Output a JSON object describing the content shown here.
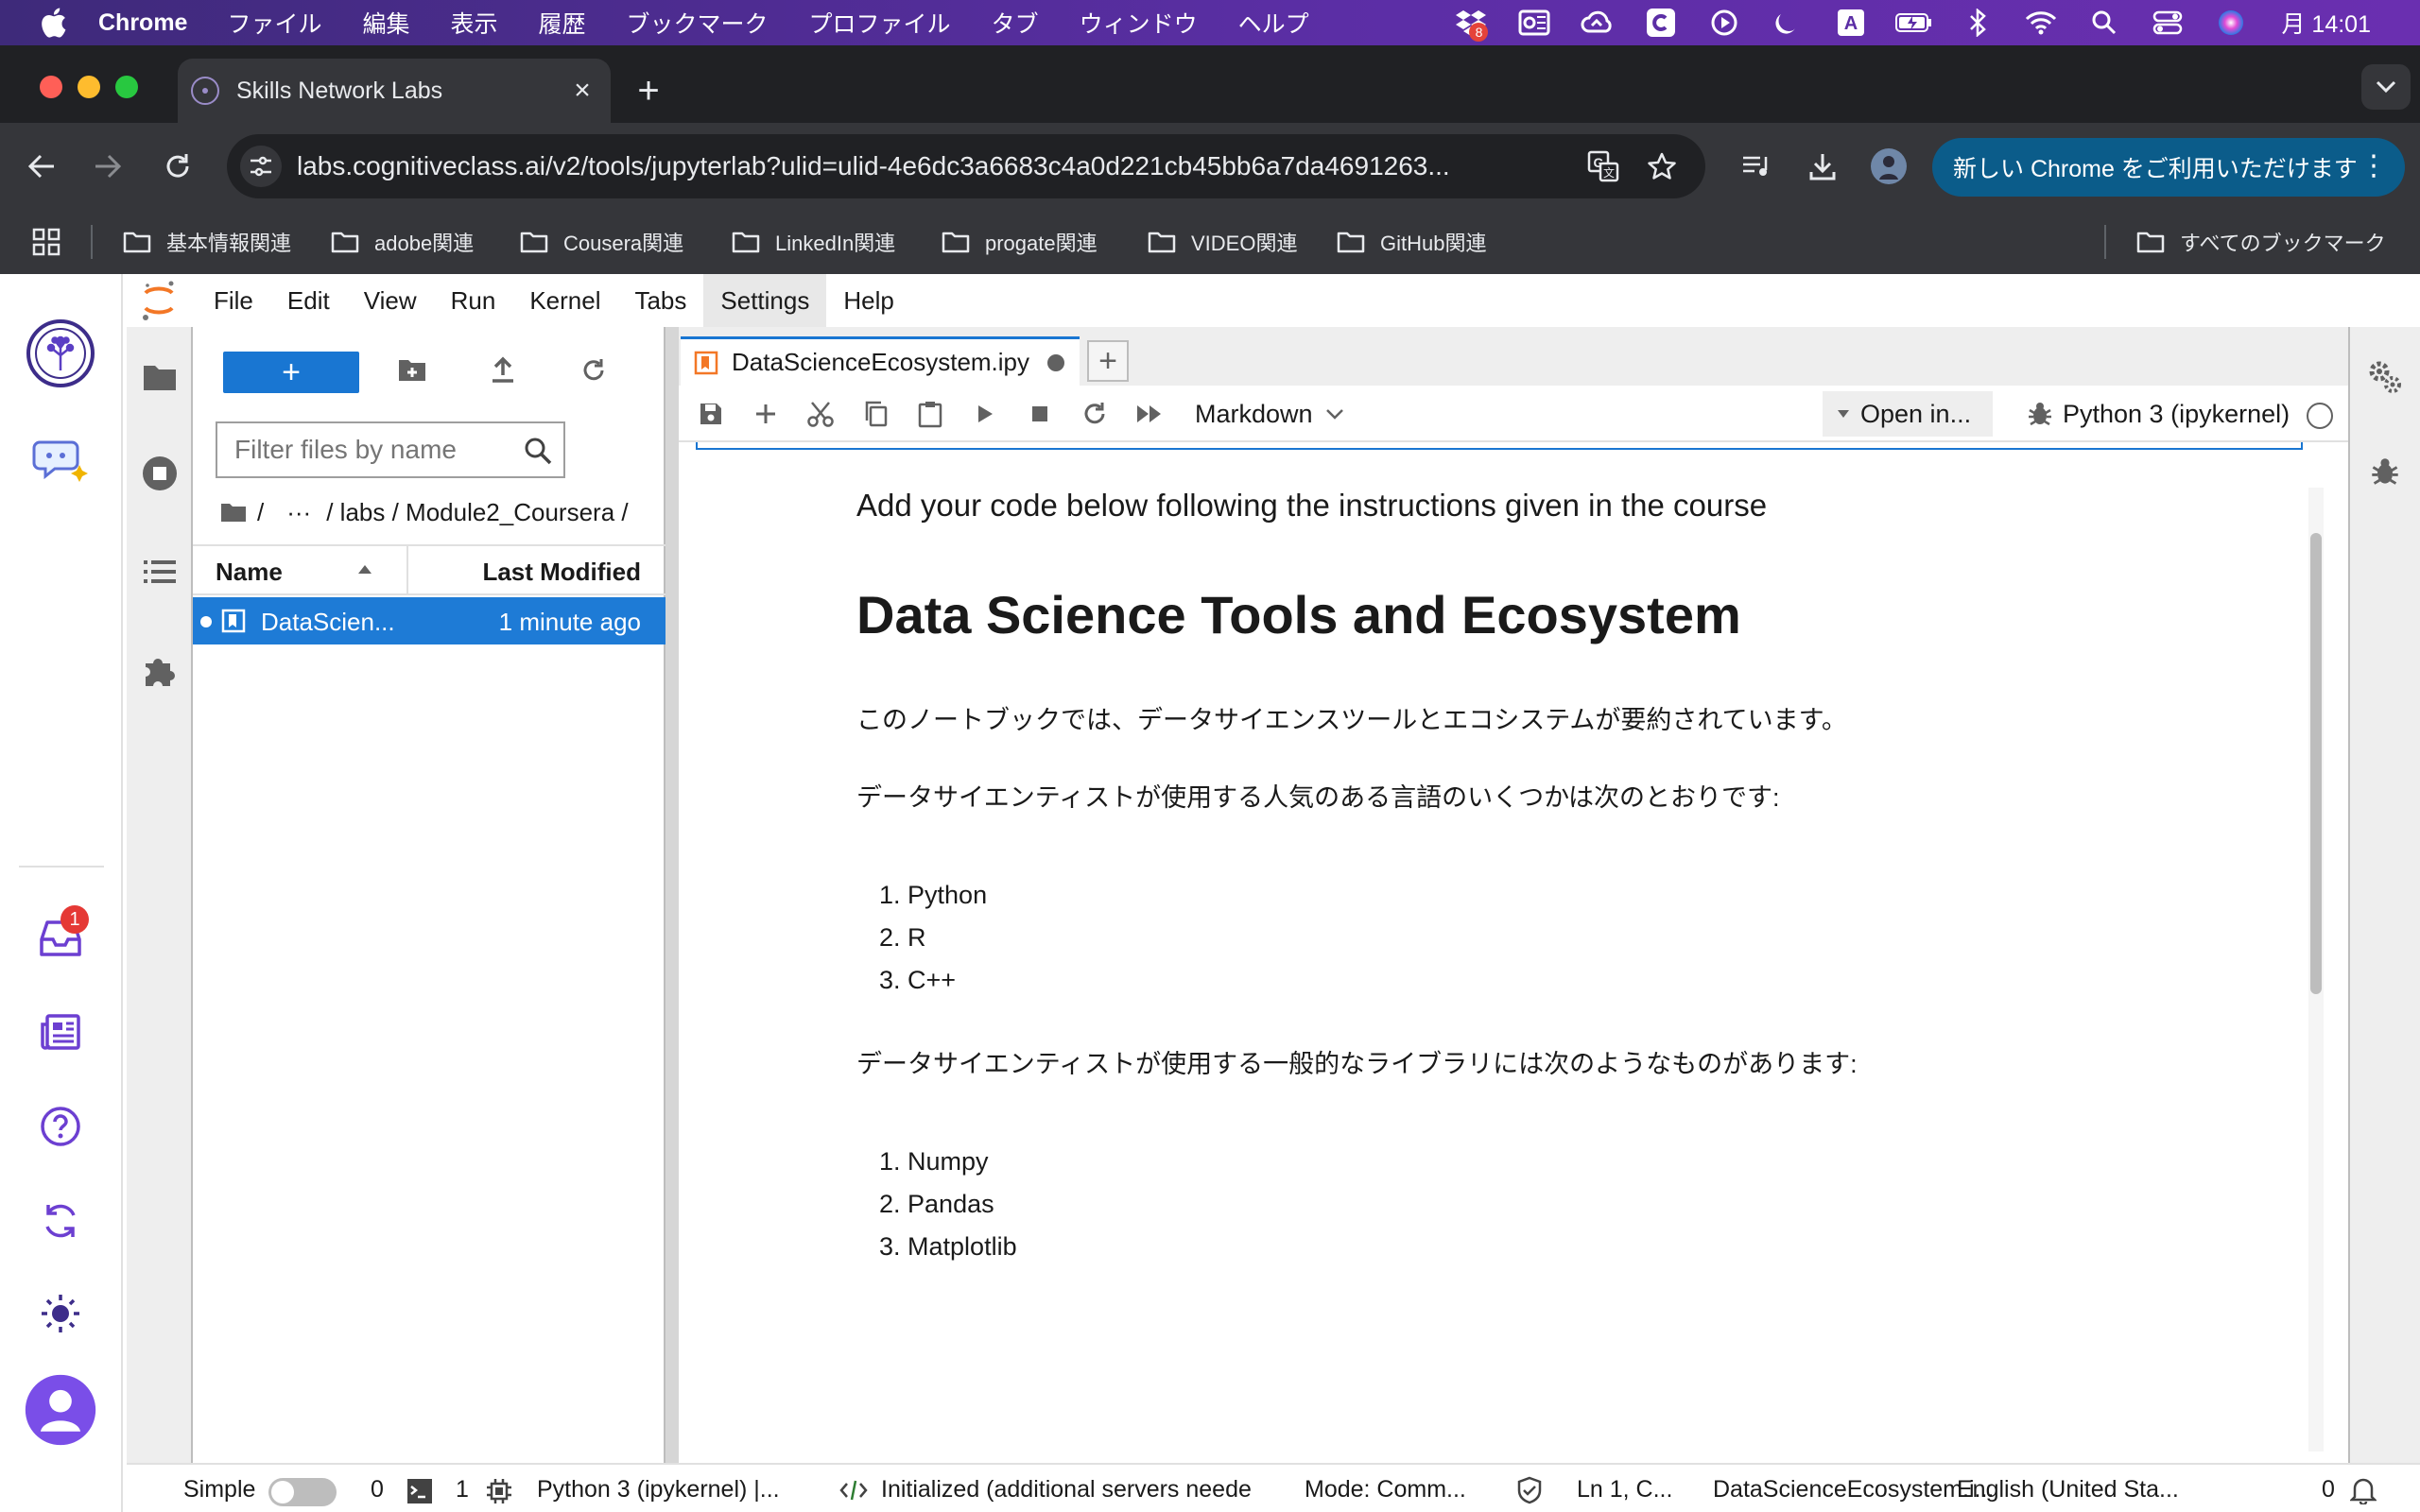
{
  "mac_menubar": {
    "app_name": "Chrome",
    "menus": [
      "ファイル",
      "編集",
      "表示",
      "履歴",
      "ブックマーク",
      "プロファイル",
      "タブ",
      "ウィンドウ",
      "ヘルプ"
    ],
    "dropbox_badge": "8",
    "clock": "月 14:01"
  },
  "browser": {
    "tab_title": "Skills Network Labs",
    "url": "labs.cognitiveclass.ai/v2/tools/jupyterlab?ulid=ulid-4e6dc3a6683c4a0d221cb45bb6a7da4691263...",
    "update_button": "新しい Chrome をご利用いただけます",
    "bookmarks": [
      "基本情報関連",
      "adobe関連",
      "Cousera関連",
      "LinkedIn関連",
      "progate関連",
      "VIDEO関連",
      "GitHub関連"
    ],
    "all_bookmarks": "すべてのブックマーク"
  },
  "jupyter": {
    "menus": [
      "File",
      "Edit",
      "View",
      "Run",
      "Kernel",
      "Tabs",
      "Settings",
      "Help"
    ],
    "inbox_badge": "1",
    "file_browser": {
      "new_label": "+",
      "filter_placeholder": "Filter files by name",
      "breadcrumb": [
        "/",
        "···",
        "/ labs / Module2_Coursera /"
      ],
      "col_name": "Name",
      "col_modified": "Last Modified",
      "files": [
        {
          "name": "DataScien...",
          "modified": "1 minute ago"
        }
      ]
    },
    "notebook": {
      "tab_title": "DataScienceEcosystem.ipy",
      "cell_type": "Markdown",
      "open_in": "Open in...",
      "kernel": "Python 3 (ipykernel)",
      "subtitle": "Add your code below following the instructions given in the course",
      "heading": "Data Science Tools and Ecosystem",
      "intro": "このノートブックでは、データサイエンスツールとエコシステムが要約されています。",
      "languages_intro": "データサイエンティストが使用する人気のある言語のいくつかは次のとおりです:",
      "languages": [
        "Python",
        "R",
        "C++"
      ],
      "libraries_intro": "データサイエンティストが使用する一般的なライブラリには次のようなものがあります:",
      "libraries": [
        "Numpy",
        "Pandas",
        "Matplotlib"
      ]
    },
    "statusbar": {
      "mode_label": "Simple",
      "count_a": "0",
      "count_b": "1",
      "kernel": "Python 3 (ipykernel) |...",
      "lsp": "Initialized (additional servers neede",
      "mode": "Mode: Comm...",
      "cursor": "Ln 1, C...",
      "file": "DataScienceEcosystem.i...",
      "language": "English (United Sta...",
      "notifications": "0"
    }
  },
  "colors": {
    "menubar": "#5b2ea5",
    "chrome_dark": "#202124",
    "chrome_toolbar": "#35363a",
    "jupyter_blue": "#1976d2",
    "accent_purple": "#6c3fd1"
  }
}
